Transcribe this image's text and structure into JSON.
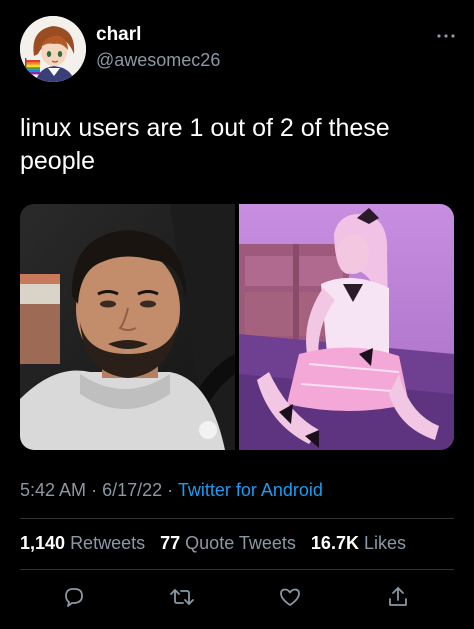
{
  "author": {
    "display_name": "charl",
    "handle": "@awesomec26",
    "avatar_icon": "anime-avatar-icon"
  },
  "tweet": {
    "text": "linux users are 1 out of 2 of these people",
    "media_count": 2
  },
  "meta": {
    "time": "5:42 AM",
    "date": "6/17/22",
    "separator": "·",
    "client": "Twitter for Android"
  },
  "stats": {
    "retweets_count": "1,140",
    "retweets_label": "Retweets",
    "quotes_count": "77",
    "quotes_label": "Quote Tweets",
    "likes_count": "16.7K",
    "likes_label": "Likes"
  },
  "actions": [
    "reply-icon",
    "retweet-icon",
    "like-icon",
    "share-icon"
  ],
  "colors": {
    "background": "#000000",
    "text": "#ffffff",
    "secondary": "#8b98a5",
    "link": "#1d9bf0",
    "divider": "#2f3336"
  }
}
